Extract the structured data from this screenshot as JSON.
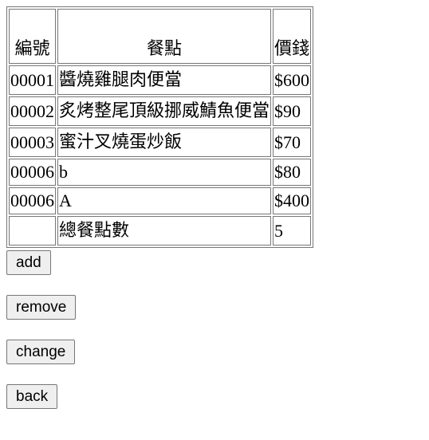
{
  "table": {
    "headers": {
      "id": "編號",
      "item": "餐點",
      "price": "價錢"
    },
    "rows": [
      {
        "id": "00001",
        "item": "醬燒雞腿肉便當",
        "price": "$600"
      },
      {
        "id": "00002",
        "item": "炙烤整尾頂級挪威鯖魚便當",
        "price": "$90"
      },
      {
        "id": "00003",
        "item": "蜜汁叉燒蛋炒飯",
        "price": "$70"
      },
      {
        "id": "00006",
        "item": "b",
        "price": "$80"
      },
      {
        "id": "00006",
        "item": "A",
        "price": "$400"
      }
    ],
    "footer": {
      "id": "",
      "label": "總餐點數",
      "count": "5"
    }
  },
  "buttons": {
    "add": "add",
    "remove": "remove",
    "change": "change",
    "back": "back"
  }
}
